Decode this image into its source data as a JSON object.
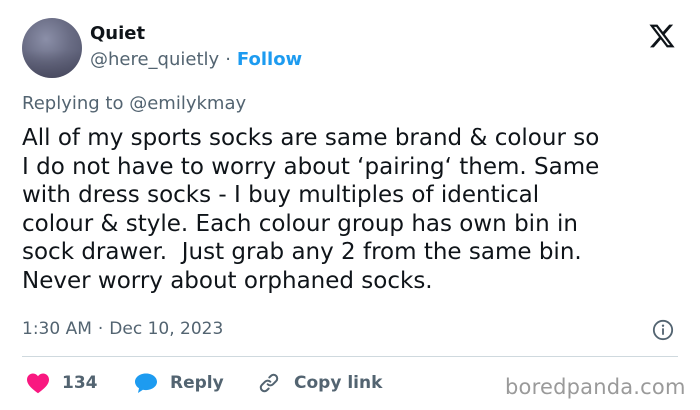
{
  "user": {
    "display_name": "Quiet",
    "handle": "@here_quietly",
    "separator": "·",
    "follow_label": "Follow"
  },
  "reply_context": {
    "prefix": "Replying to",
    "mention": "@emilykmay"
  },
  "tweet_lines": [
    "All of my sports socks are same brand & colour so",
    "I do not have to worry about ‘pairing‘ them. Same",
    "with dress socks - I buy multiples of identical",
    "colour & style. Each colour group has own bin in",
    "sock drawer.  Just grab any 2 from the same bin.",
    "Never worry about orphaned socks."
  ],
  "timestamp": {
    "time": "1:30 AM",
    "separator": "·",
    "date": "Dec 10, 2023"
  },
  "actions": {
    "like_count": "134",
    "reply_label": "Reply",
    "copy_link_label": "Copy link"
  },
  "watermark": "boredpanda.com",
  "icons": {
    "brand": "x-logo-icon",
    "info": "info-icon",
    "like": "heart-icon",
    "reply": "reply-bubble-icon",
    "copy": "link-icon"
  },
  "colors": {
    "text": "#0f1419",
    "secondary": "#536471",
    "accent": "#1d9bf0",
    "like": "#f91880",
    "divider": "#cfd9de",
    "watermark": "#9a9a9a"
  }
}
